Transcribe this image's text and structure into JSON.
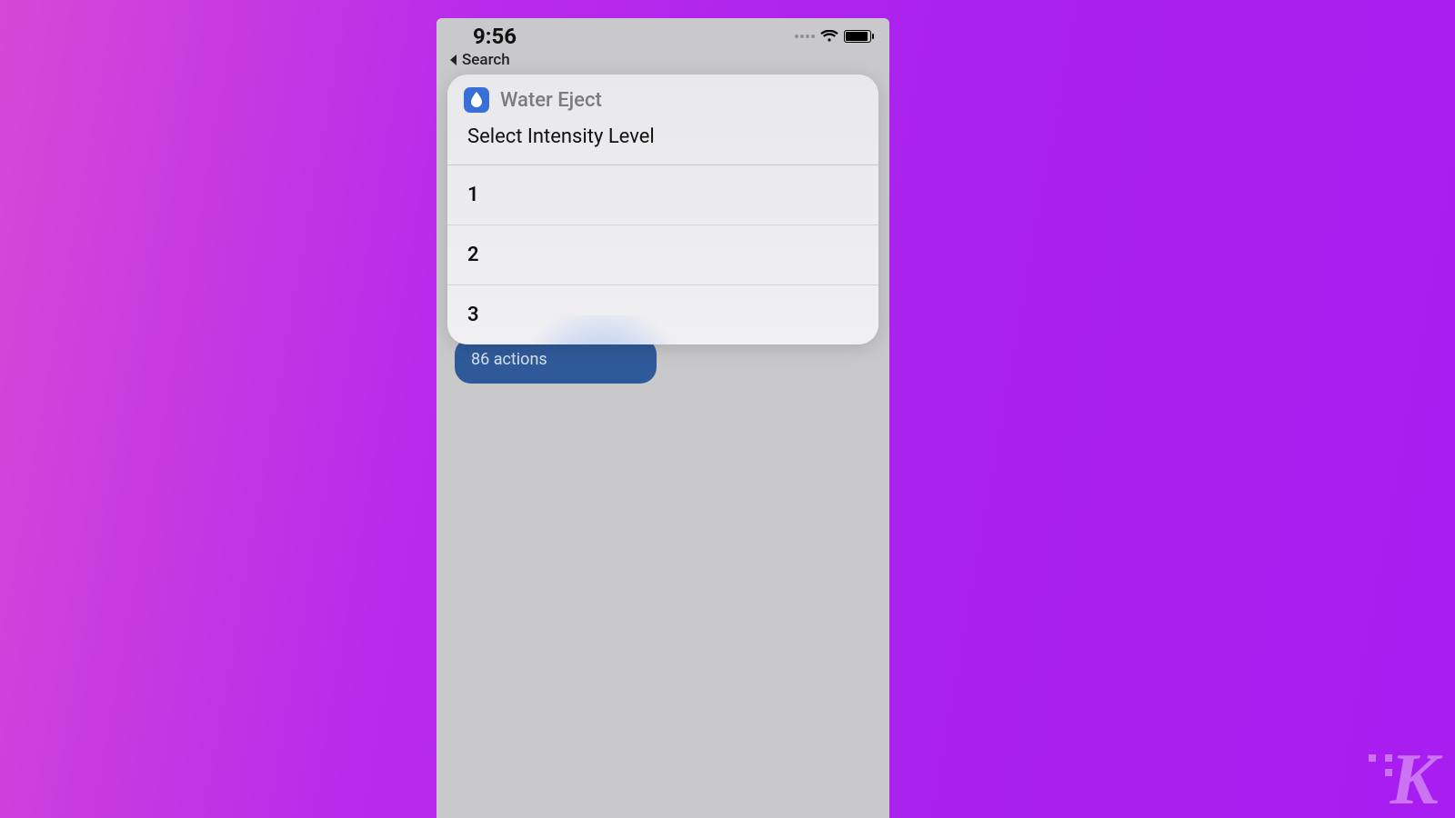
{
  "statusbar": {
    "time": "9:56"
  },
  "breadcrumb": {
    "label": "Search"
  },
  "popup": {
    "app_name": "Water Eject",
    "title": "Select Intensity Level",
    "options": [
      "1",
      "2",
      "3"
    ]
  },
  "shortcut_card": {
    "subtitle": "86 actions"
  },
  "watermark": {
    "letter": "K"
  }
}
